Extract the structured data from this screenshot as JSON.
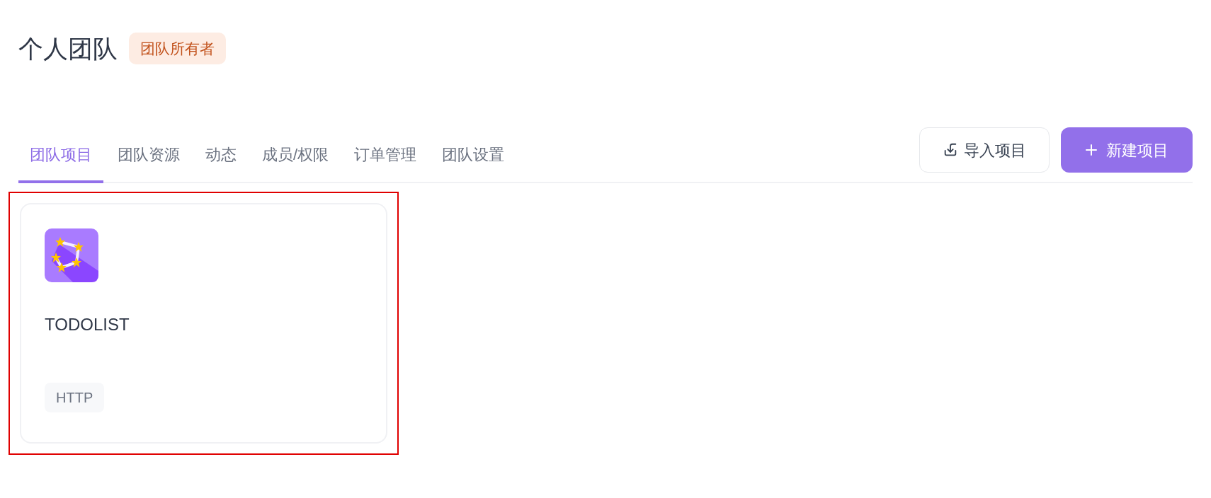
{
  "header": {
    "title": "个人团队",
    "badge": "团队所有者"
  },
  "tabs": [
    {
      "label": "团队项目",
      "selected": true
    },
    {
      "label": "团队资源",
      "selected": false
    },
    {
      "label": "动态",
      "selected": false
    },
    {
      "label": "成员/权限",
      "selected": false
    },
    {
      "label": "订单管理",
      "selected": false
    },
    {
      "label": "团队设置",
      "selected": false
    }
  ],
  "actions": [
    {
      "kind": "import",
      "label": "导入项目"
    },
    {
      "kind": "create",
      "label": "新建项目"
    }
  ],
  "projects": [
    {
      "name": "TODOLIST",
      "tag": "HTTP",
      "highlighted": true
    }
  ]
}
